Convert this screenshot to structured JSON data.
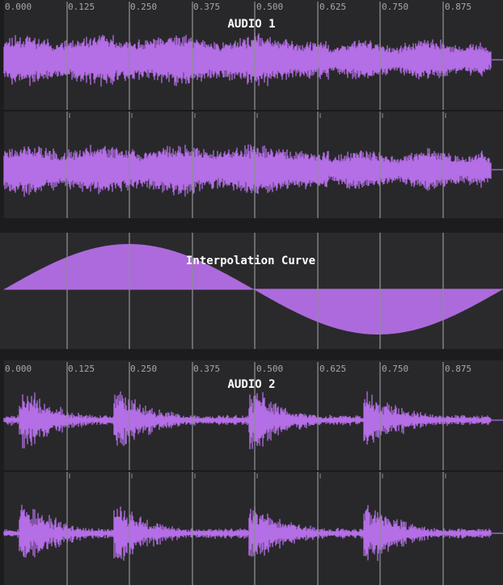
{
  "ruler": {
    "tick_labels": [
      "0.000",
      "0.125",
      "0.250",
      "0.375",
      "0.500",
      "0.625",
      "0.750",
      "0.875"
    ],
    "tick_positions": [
      0.0,
      0.125,
      0.25,
      0.375,
      0.5,
      0.625,
      0.75,
      0.875
    ]
  },
  "audio1": {
    "title": "AUDIO 1"
  },
  "curve": {
    "title": "Interpolation Curve"
  },
  "audio2": {
    "title": "AUDIO 2"
  },
  "colors": {
    "waveform": "#b46ee6",
    "gridline": "#8e8e94",
    "panel_bg": "#28282a",
    "curve_bg": "#2a2a2c",
    "title_text": "#ffffff",
    "ruler_text": "#a6a6ae"
  }
}
